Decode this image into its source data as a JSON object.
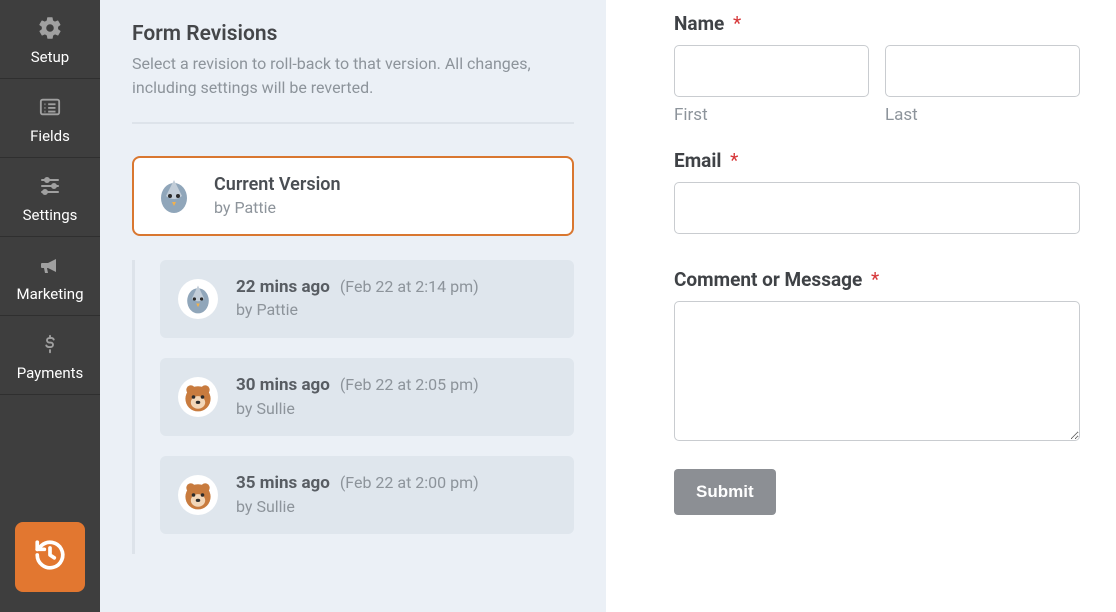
{
  "sidebar": {
    "items": [
      {
        "label": "Setup",
        "icon": "gear-icon"
      },
      {
        "label": "Fields",
        "icon": "list-icon"
      },
      {
        "label": "Settings",
        "icon": "sliders-icon"
      },
      {
        "label": "Marketing",
        "icon": "bullhorn-icon"
      },
      {
        "label": "Payments",
        "icon": "dollar-icon"
      }
    ],
    "revisions_button_icon": "history-icon"
  },
  "revisions": {
    "title": "Form Revisions",
    "subtitle": "Select a revision to roll-back to that version. All changes, including settings will be reverted.",
    "current": {
      "label": "Current Version",
      "by_prefix": "by ",
      "author": "Pattie",
      "avatar": "bird"
    },
    "history": [
      {
        "time_ago": "22 mins ago",
        "timestamp": "(Feb 22 at 2:14 pm)",
        "by_prefix": "by ",
        "author": "Pattie",
        "avatar": "bird"
      },
      {
        "time_ago": "30 mins ago",
        "timestamp": "(Feb 22 at 2:05 pm)",
        "by_prefix": "by ",
        "author": "Sullie",
        "avatar": "bear"
      },
      {
        "time_ago": "35 mins ago",
        "timestamp": "(Feb 22 at 2:00 pm)",
        "by_prefix": "by ",
        "author": "Sullie",
        "avatar": "bear"
      }
    ]
  },
  "form": {
    "name": {
      "label": "Name",
      "required_marker": "*",
      "first_sub": "First",
      "last_sub": "Last"
    },
    "email": {
      "label": "Email",
      "required_marker": "*"
    },
    "comment": {
      "label": "Comment or Message",
      "required_marker": "*"
    },
    "submit_label": "Submit"
  },
  "colors": {
    "accent": "#e27730",
    "panel_bg": "#ebf0f6",
    "sidebar_bg": "#3e3e3e"
  }
}
